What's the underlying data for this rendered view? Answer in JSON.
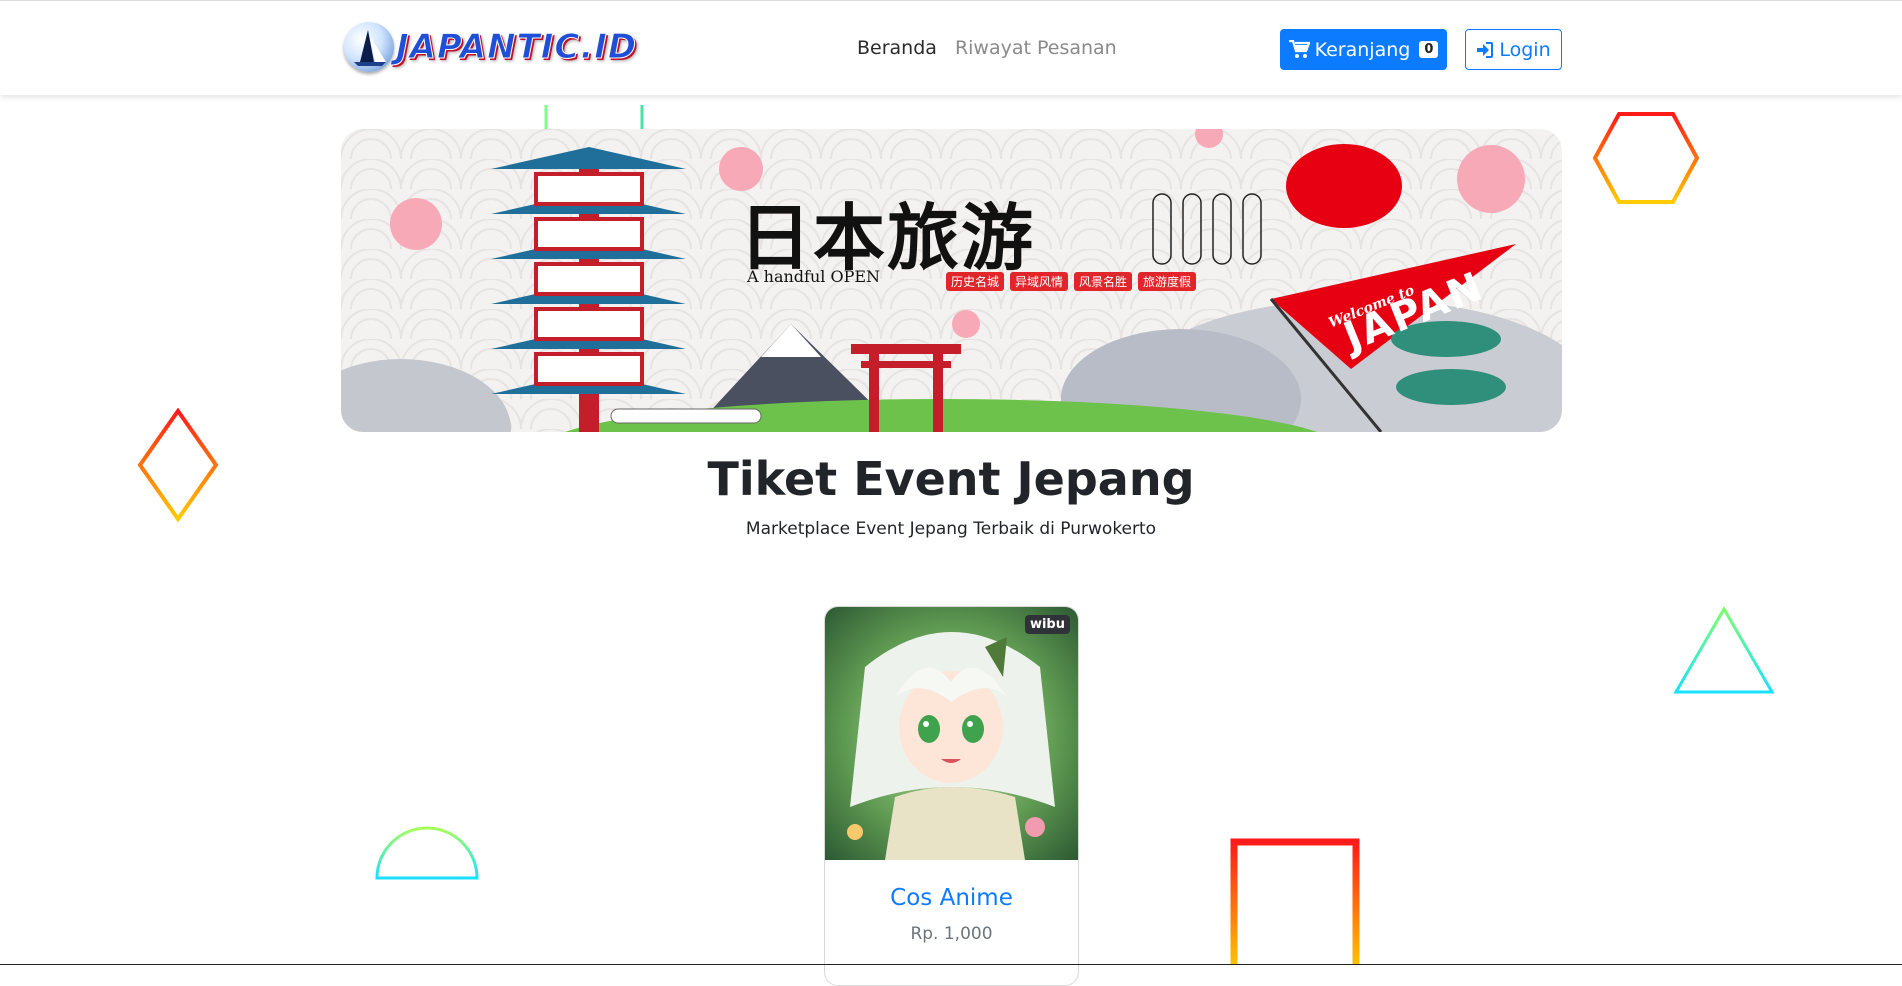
{
  "navbar": {
    "brand_text": "JAPANTIC.ID",
    "links": [
      {
        "label": "Beranda",
        "active": true
      },
      {
        "label": "Riwayat Pesanan",
        "active": false
      }
    ],
    "cart_label": "Keranjang",
    "cart_count": "0",
    "login_label": "Login"
  },
  "hero": {
    "title": "日本旅游",
    "subtitle": "A handful  OPEN",
    "tags": [
      "历史名城",
      "异域风情",
      "风景名胜",
      "旅游度假"
    ],
    "welcome": "Welcome to",
    "japan": "JAPAN"
  },
  "main": {
    "title": "Tiket Event Jepang",
    "subtitle": "Marketplace Event Jepang Terbaik di Purwokerto"
  },
  "products": [
    {
      "name": "Cos Anime",
      "price": "Rp. 1,000",
      "category": "wibu"
    }
  ],
  "colors": {
    "primary": "#0d7bff",
    "deco_warm_start": "#ff1a1a",
    "deco_warm_end": "#ffcc00",
    "deco_cool_start": "#7dff6a",
    "deco_cool_end": "#1ae0ff"
  }
}
